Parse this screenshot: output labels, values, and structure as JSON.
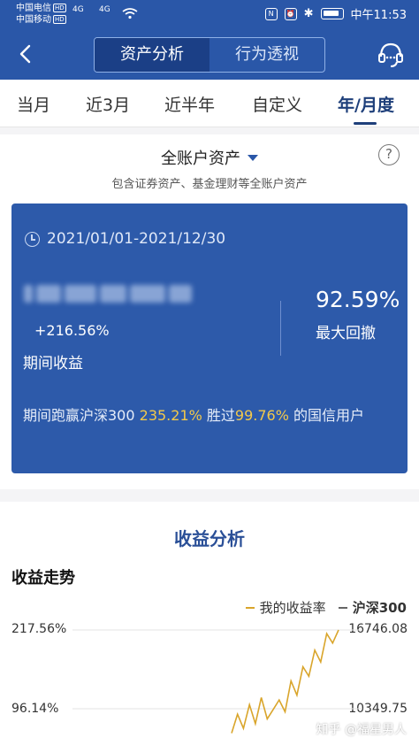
{
  "status_bar": {
    "carrier1": "中国电信",
    "carrier2": "中国移动",
    "hd_badge": "HD",
    "signal1": "4G",
    "signal2": "4G",
    "nfc": "N",
    "alarm": "⏰",
    "bluetooth": "✱",
    "time": "中午11:53"
  },
  "header": {
    "segments": [
      "资产分析",
      "行为透视"
    ],
    "active_segment": 0
  },
  "tabs": {
    "items": [
      "当月",
      "近3月",
      "近半年",
      "自定义",
      "年/月度"
    ],
    "active": "年/月度"
  },
  "account": {
    "title": "全账户资产",
    "help": "?",
    "subtitle": "包含证券资产、基金理财等全账户资产"
  },
  "card": {
    "date_range": "2021/01/01-2021/12/30",
    "profit_pct": "+216.56%",
    "profit_label": "期间收益",
    "max_drawdown_value": "92.59%",
    "max_drawdown_label": "最大回撤",
    "beat_prefix": "期间跑赢沪深300 ",
    "beat_value": "235.21%",
    "beat_mid": "  胜过",
    "beat_rank": "99.76%",
    "beat_suffix": " 的国信用户"
  },
  "income": {
    "section_title": "收益分析",
    "trend_title": "收益走势",
    "legend_mine": "我的收益率",
    "legend_index": "沪深300",
    "y_left_top": "217.56%",
    "y_left_mid": "96.14%",
    "y_right_top": "16746.08",
    "y_right_mid": "10349.75"
  },
  "watermark": "知乎 @福星男人",
  "colors": {
    "primary": "#2a57a8",
    "card": "#2d5aaa",
    "highlight": "#f3c94a",
    "line_mine": "#d9a52b"
  },
  "chart_data": {
    "type": "line",
    "series": [
      {
        "name": "我的收益率",
        "values": [
          0,
          40,
          10,
          60,
          20,
          75,
          30,
          50,
          70,
          45,
          110,
          80,
          140,
          120,
          175,
          150,
          210,
          190,
          217.56
        ]
      }
    ],
    "ylabel_left_ticks": [
      "217.56%",
      "96.14%"
    ],
    "ylabel_right_ticks": [
      "16746.08",
      "10349.75"
    ],
    "ylim": [
      -25,
      217.56
    ]
  }
}
